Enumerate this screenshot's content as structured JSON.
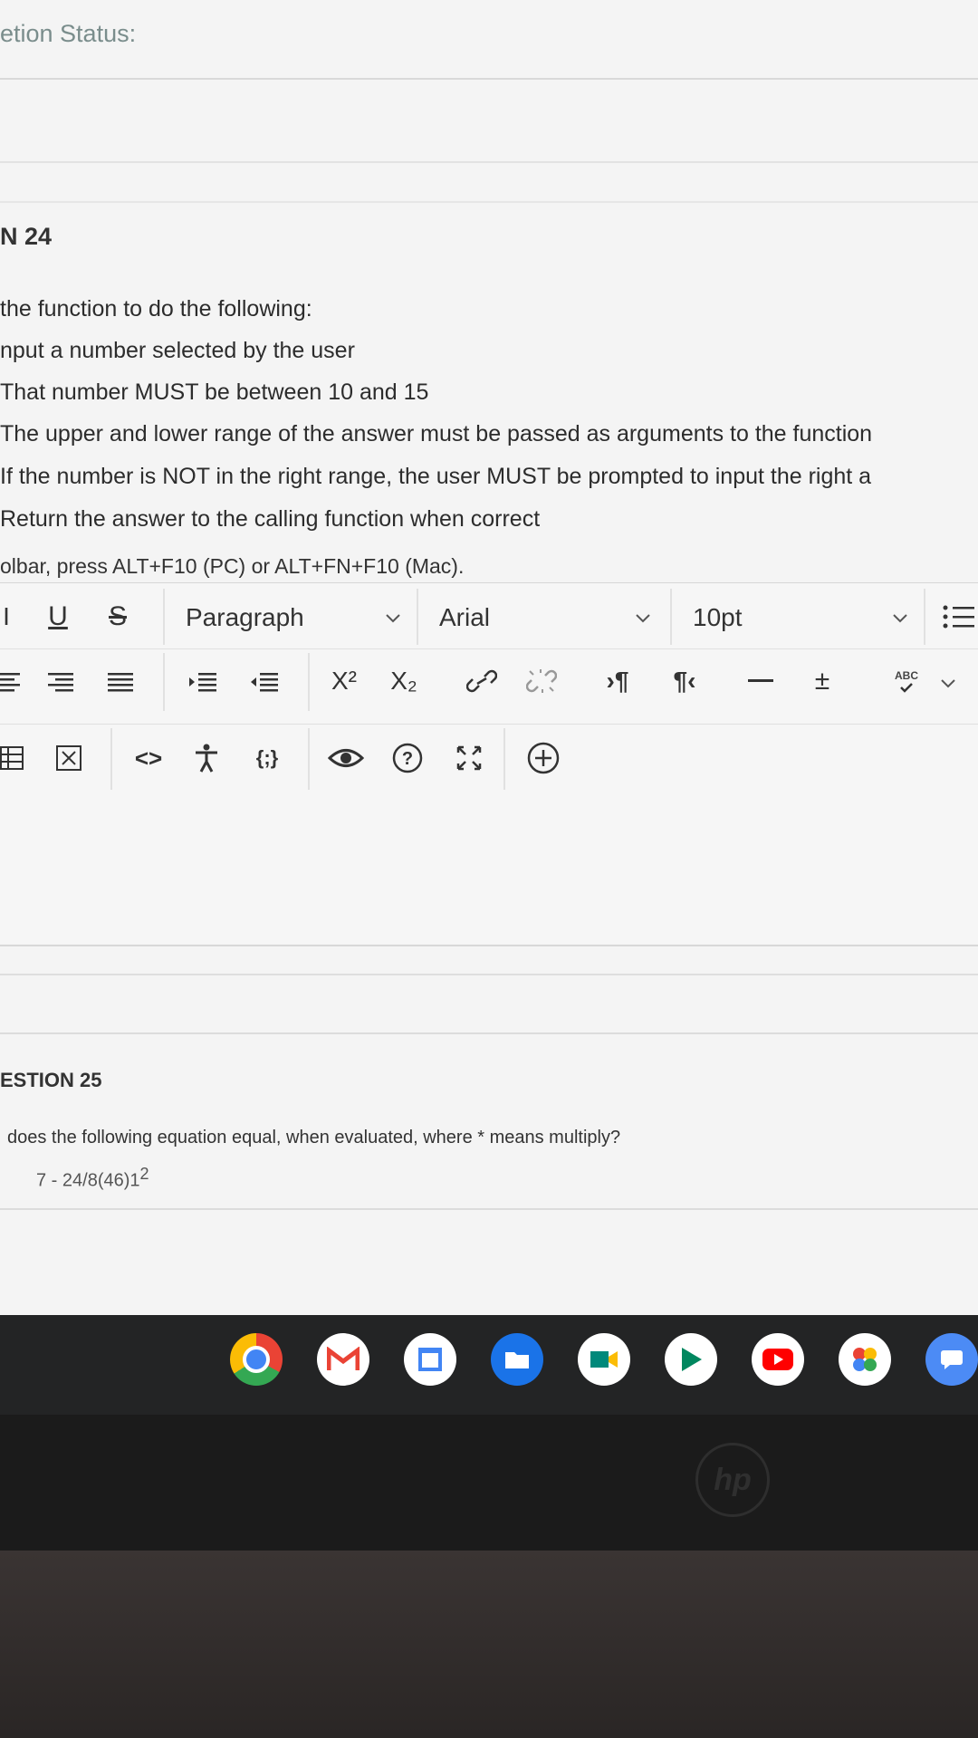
{
  "page": {
    "status_label": "etion Status:",
    "question_24": {
      "title": "N 24",
      "lines": [
        "the function to do the following:",
        "nput a number selected by the user",
        "That number MUST be between 10 and 15",
        "The upper and lower range of the answer must be passed as arguments to the function",
        "If the number is NOT in the right range, the user MUST be prompted to input the right a",
        "Return the answer to the calling function when correct"
      ],
      "toolbar_hint": "olbar, press ALT+F10 (PC) or ALT+FN+F10 (Mac)."
    },
    "question_25": {
      "title": "ESTION 25",
      "text": "does the following equation equal, when evaluated, where * means multiply?",
      "equation": "7 - 24/8(46)1",
      "equation_sup": "2"
    }
  },
  "toolbar": {
    "paragraph_label": "Paragraph",
    "font_label": "Arial",
    "size_label": "10pt",
    "superscript_label": "X²",
    "subscript_label": "X₂",
    "spellcheck_label": "ABC",
    "code_label": "<>",
    "block_label": "{;}",
    "icons": [
      "underline-icon",
      "strikethrough-icon",
      "list-icon",
      "align-left-icon",
      "align-center-icon",
      "justify-icon",
      "indent-icon",
      "outdent-icon",
      "link-icon",
      "unlink-icon",
      "ltr-icon",
      "rtl-icon",
      "horizontal-line-icon",
      "plus-minus-icon",
      "spellcheck-icon",
      "table-icon",
      "image-icon",
      "code-icon",
      "accessibility-icon",
      "eye-icon",
      "help-icon",
      "fullscreen-icon",
      "add-content-icon"
    ]
  },
  "shelf": {
    "apps": [
      "chrome-icon",
      "gmail-icon",
      "calendar-icon",
      "files-icon",
      "meet-icon",
      "play-store-icon",
      "youtube-icon",
      "photos-icon",
      "messages-icon"
    ],
    "colors": {
      "chrome": "#4285f4",
      "gmail": "#ffffff",
      "calendar": "#ffffff",
      "files": "#1a73e8",
      "meet": "#ffffff",
      "play": "#ffffff",
      "youtube": "#ff0000",
      "photos": "#ffffff",
      "messages": "#4c8bf5"
    }
  }
}
